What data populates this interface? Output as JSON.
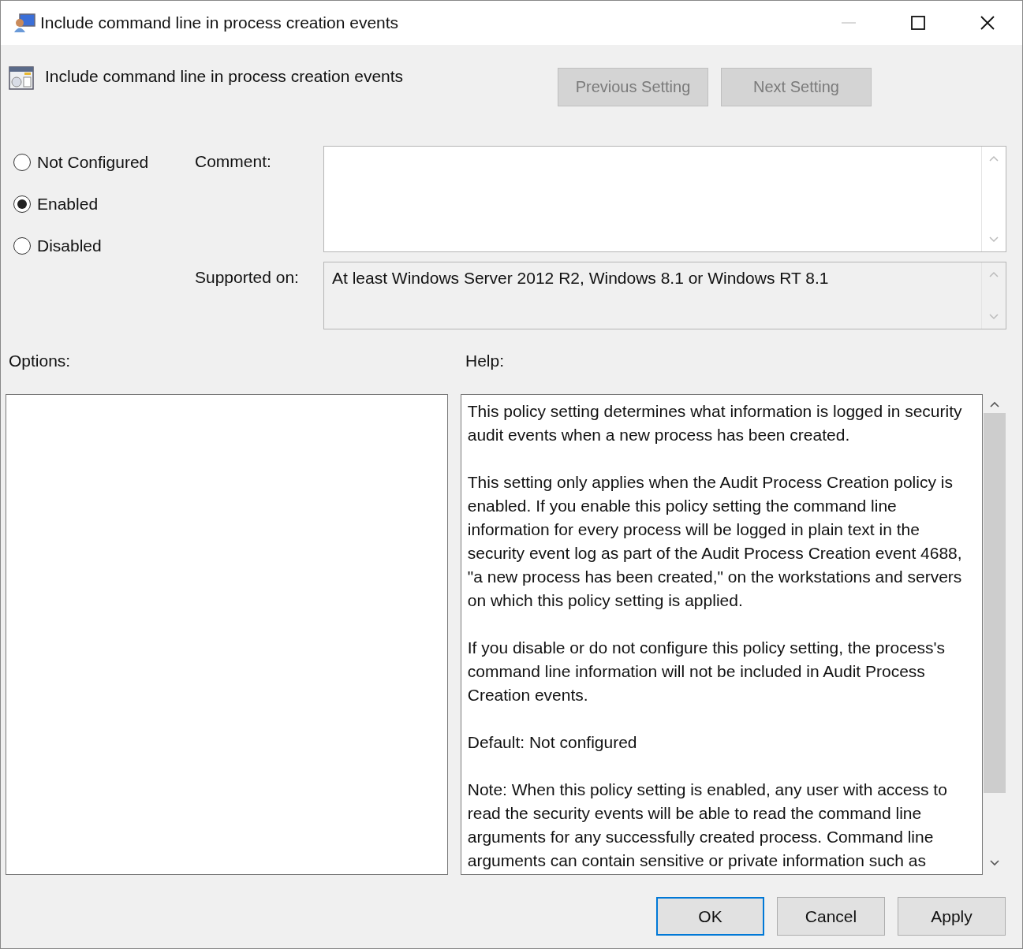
{
  "window": {
    "title": "Include command line in process creation events"
  },
  "heading": "Include command line in process creation events",
  "nav_buttons": [
    {
      "label": "Previous Setting",
      "disabled": true
    },
    {
      "label": "Next Setting",
      "disabled": true
    }
  ],
  "state_options": [
    {
      "label": "Not Configured",
      "selected": false
    },
    {
      "label": "Enabled",
      "selected": true
    },
    {
      "label": "Disabled",
      "selected": false
    }
  ],
  "comment": {
    "label": "Comment:"
  },
  "supported_on": {
    "label": "Supported on:",
    "value": "At least Windows Server 2012 R2, Windows 8.1 or Windows RT 8.1"
  },
  "options": {
    "label": "Options:"
  },
  "help": {
    "label": "Help:",
    "paragraphs": [
      "This policy setting determines what information is logged in security audit events when a new process has been created.",
      "This setting only applies when the Audit Process Creation policy is enabled. If you enable this policy setting the command line information for every process will be logged in plain text in the security event log as part of the Audit Process Creation event 4688, \"a new process has been created,\" on the workstations and servers on which this policy setting is applied.",
      "If you disable or do not configure this policy setting, the process's command line information will not be included in Audit Process Creation events.",
      "Default: Not configured",
      "Note: When this policy setting is enabled, any user with access to read the security events will be able to read the command line arguments for any successfully created process. Command line arguments can contain sensitive or private information such as"
    ]
  },
  "buttons": [
    {
      "label": "OK",
      "default": true
    },
    {
      "label": "Cancel",
      "default": false
    },
    {
      "label": "Apply",
      "default": false
    }
  ]
}
